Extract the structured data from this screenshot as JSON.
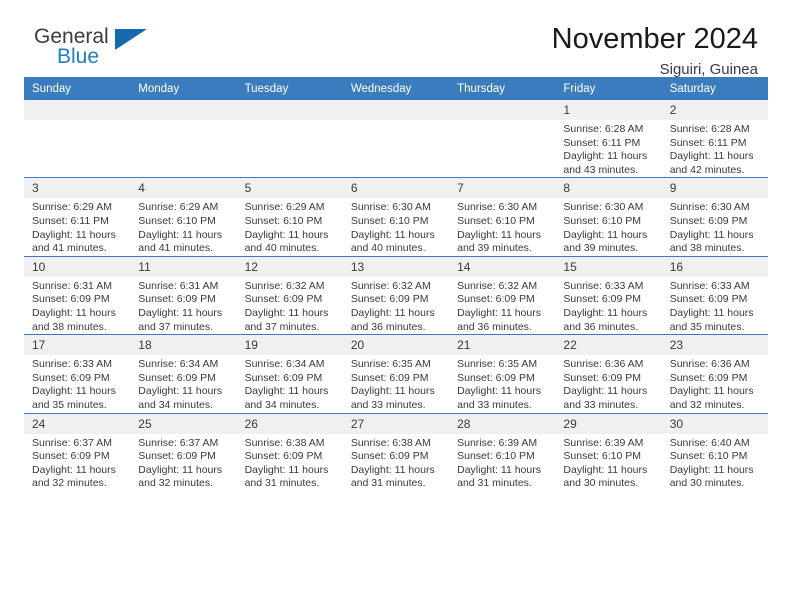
{
  "brand": {
    "name_part1": "General",
    "name_part2": "Blue",
    "flag_icon": "triangle-flag-icon"
  },
  "header": {
    "title": "November 2024",
    "subtitle": "Siguiri, Guinea"
  },
  "colors": {
    "header_blue": "#3a7cbd",
    "brand_blue": "#1f7fc4",
    "daynum_bg": "#f0f0f0",
    "text": "#3a3a3a"
  },
  "calendar": {
    "weekday_headers": [
      "Sunday",
      "Monday",
      "Tuesday",
      "Wednesday",
      "Thursday",
      "Friday",
      "Saturday"
    ],
    "labels": {
      "sunrise": "Sunrise:",
      "sunset": "Sunset:",
      "daylight": "Daylight:"
    },
    "weeks": [
      [
        {
          "day": "",
          "blank": true
        },
        {
          "day": "",
          "blank": true
        },
        {
          "day": "",
          "blank": true
        },
        {
          "day": "",
          "blank": true
        },
        {
          "day": "",
          "blank": true
        },
        {
          "day": "1",
          "sunrise": "Sunrise: 6:28 AM",
          "sunset": "Sunset: 6:11 PM",
          "daylight": "Daylight: 11 hours and 43 minutes."
        },
        {
          "day": "2",
          "sunrise": "Sunrise: 6:28 AM",
          "sunset": "Sunset: 6:11 PM",
          "daylight": "Daylight: 11 hours and 42 minutes."
        }
      ],
      [
        {
          "day": "3",
          "sunrise": "Sunrise: 6:29 AM",
          "sunset": "Sunset: 6:11 PM",
          "daylight": "Daylight: 11 hours and 41 minutes."
        },
        {
          "day": "4",
          "sunrise": "Sunrise: 6:29 AM",
          "sunset": "Sunset: 6:10 PM",
          "daylight": "Daylight: 11 hours and 41 minutes."
        },
        {
          "day": "5",
          "sunrise": "Sunrise: 6:29 AM",
          "sunset": "Sunset: 6:10 PM",
          "daylight": "Daylight: 11 hours and 40 minutes."
        },
        {
          "day": "6",
          "sunrise": "Sunrise: 6:30 AM",
          "sunset": "Sunset: 6:10 PM",
          "daylight": "Daylight: 11 hours and 40 minutes."
        },
        {
          "day": "7",
          "sunrise": "Sunrise: 6:30 AM",
          "sunset": "Sunset: 6:10 PM",
          "daylight": "Daylight: 11 hours and 39 minutes."
        },
        {
          "day": "8",
          "sunrise": "Sunrise: 6:30 AM",
          "sunset": "Sunset: 6:10 PM",
          "daylight": "Daylight: 11 hours and 39 minutes."
        },
        {
          "day": "9",
          "sunrise": "Sunrise: 6:30 AM",
          "sunset": "Sunset: 6:09 PM",
          "daylight": "Daylight: 11 hours and 38 minutes."
        }
      ],
      [
        {
          "day": "10",
          "sunrise": "Sunrise: 6:31 AM",
          "sunset": "Sunset: 6:09 PM",
          "daylight": "Daylight: 11 hours and 38 minutes."
        },
        {
          "day": "11",
          "sunrise": "Sunrise: 6:31 AM",
          "sunset": "Sunset: 6:09 PM",
          "daylight": "Daylight: 11 hours and 37 minutes."
        },
        {
          "day": "12",
          "sunrise": "Sunrise: 6:32 AM",
          "sunset": "Sunset: 6:09 PM",
          "daylight": "Daylight: 11 hours and 37 minutes."
        },
        {
          "day": "13",
          "sunrise": "Sunrise: 6:32 AM",
          "sunset": "Sunset: 6:09 PM",
          "daylight": "Daylight: 11 hours and 36 minutes."
        },
        {
          "day": "14",
          "sunrise": "Sunrise: 6:32 AM",
          "sunset": "Sunset: 6:09 PM",
          "daylight": "Daylight: 11 hours and 36 minutes."
        },
        {
          "day": "15",
          "sunrise": "Sunrise: 6:33 AM",
          "sunset": "Sunset: 6:09 PM",
          "daylight": "Daylight: 11 hours and 36 minutes."
        },
        {
          "day": "16",
          "sunrise": "Sunrise: 6:33 AM",
          "sunset": "Sunset: 6:09 PM",
          "daylight": "Daylight: 11 hours and 35 minutes."
        }
      ],
      [
        {
          "day": "17",
          "sunrise": "Sunrise: 6:33 AM",
          "sunset": "Sunset: 6:09 PM",
          "daylight": "Daylight: 11 hours and 35 minutes."
        },
        {
          "day": "18",
          "sunrise": "Sunrise: 6:34 AM",
          "sunset": "Sunset: 6:09 PM",
          "daylight": "Daylight: 11 hours and 34 minutes."
        },
        {
          "day": "19",
          "sunrise": "Sunrise: 6:34 AM",
          "sunset": "Sunset: 6:09 PM",
          "daylight": "Daylight: 11 hours and 34 minutes."
        },
        {
          "day": "20",
          "sunrise": "Sunrise: 6:35 AM",
          "sunset": "Sunset: 6:09 PM",
          "daylight": "Daylight: 11 hours and 33 minutes."
        },
        {
          "day": "21",
          "sunrise": "Sunrise: 6:35 AM",
          "sunset": "Sunset: 6:09 PM",
          "daylight": "Daylight: 11 hours and 33 minutes."
        },
        {
          "day": "22",
          "sunrise": "Sunrise: 6:36 AM",
          "sunset": "Sunset: 6:09 PM",
          "daylight": "Daylight: 11 hours and 33 minutes."
        },
        {
          "day": "23",
          "sunrise": "Sunrise: 6:36 AM",
          "sunset": "Sunset: 6:09 PM",
          "daylight": "Daylight: 11 hours and 32 minutes."
        }
      ],
      [
        {
          "day": "24",
          "sunrise": "Sunrise: 6:37 AM",
          "sunset": "Sunset: 6:09 PM",
          "daylight": "Daylight: 11 hours and 32 minutes."
        },
        {
          "day": "25",
          "sunrise": "Sunrise: 6:37 AM",
          "sunset": "Sunset: 6:09 PM",
          "daylight": "Daylight: 11 hours and 32 minutes."
        },
        {
          "day": "26",
          "sunrise": "Sunrise: 6:38 AM",
          "sunset": "Sunset: 6:09 PM",
          "daylight": "Daylight: 11 hours and 31 minutes."
        },
        {
          "day": "27",
          "sunrise": "Sunrise: 6:38 AM",
          "sunset": "Sunset: 6:09 PM",
          "daylight": "Daylight: 11 hours and 31 minutes."
        },
        {
          "day": "28",
          "sunrise": "Sunrise: 6:39 AM",
          "sunset": "Sunset: 6:10 PM",
          "daylight": "Daylight: 11 hours and 31 minutes."
        },
        {
          "day": "29",
          "sunrise": "Sunrise: 6:39 AM",
          "sunset": "Sunset: 6:10 PM",
          "daylight": "Daylight: 11 hours and 30 minutes."
        },
        {
          "day": "30",
          "sunrise": "Sunrise: 6:40 AM",
          "sunset": "Sunset: 6:10 PM",
          "daylight": "Daylight: 11 hours and 30 minutes."
        }
      ]
    ]
  }
}
